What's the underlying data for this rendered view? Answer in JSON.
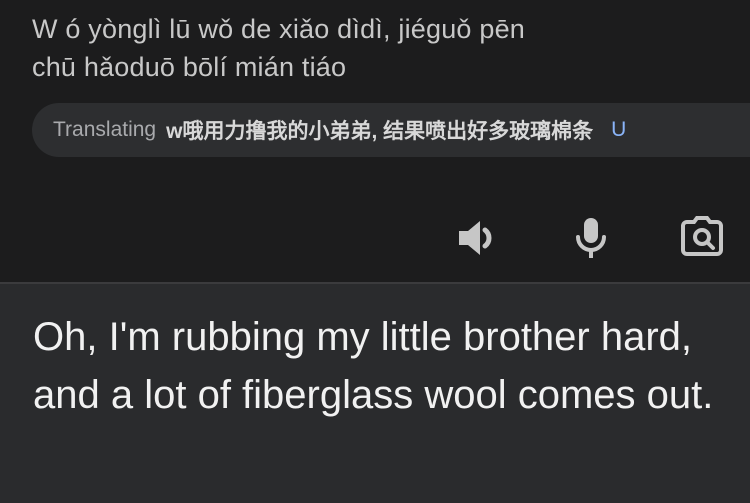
{
  "source": {
    "pinyin_line1": "W ó yònglì lū wǒ de xiǎo dìdì, jiéguǒ pēn",
    "pinyin_line2": "chū hǎoduō bōlí mián tiáo"
  },
  "translating_chip": {
    "label": "Translating",
    "text": "w哦用力撸我的小弟弟, 结果喷出好多玻璃棉条",
    "extra": "U"
  },
  "toolbar": {
    "icons": [
      "speaker-icon",
      "microphone-icon",
      "camera-search-icon"
    ]
  },
  "result": {
    "translation": "Oh, I'm rubbing my little brother hard, and a lot of fiberglass wool comes out."
  }
}
